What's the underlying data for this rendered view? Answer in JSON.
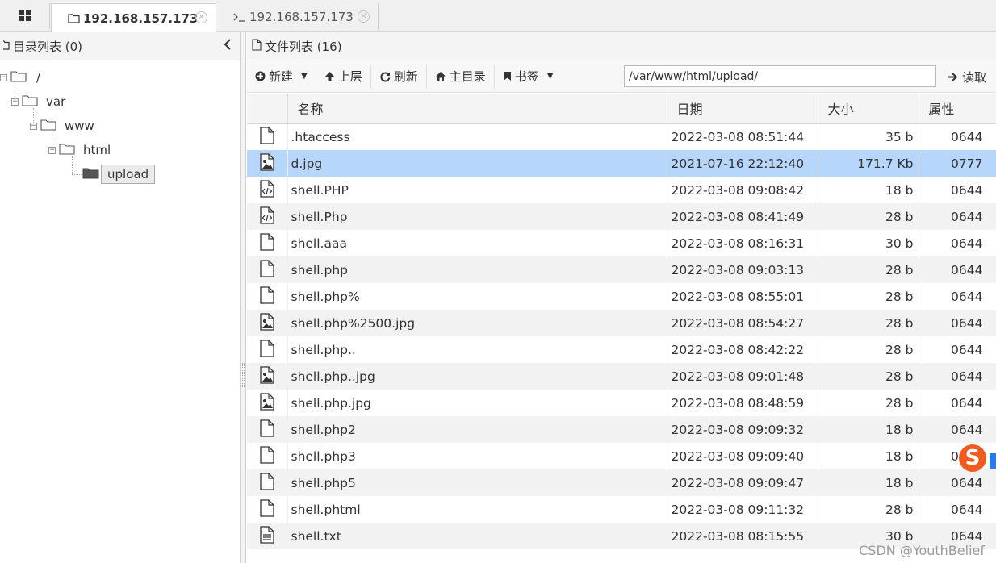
{
  "tabs": [
    {
      "label": "192.168.157.173",
      "active": true
    },
    {
      "label": "192.168.157.173",
      "active": false
    }
  ],
  "tree": {
    "header": "目录列表 (0)",
    "nodes": [
      {
        "label": "/"
      },
      {
        "label": "var"
      },
      {
        "label": "www"
      },
      {
        "label": "html"
      },
      {
        "label": "upload"
      }
    ]
  },
  "files": {
    "header": "文件列表 (16)",
    "toolbar": {
      "new_label": "新建",
      "up_label": "上层",
      "refresh_label": "刷新",
      "home_label": "主目录",
      "bookmark_label": "书签",
      "path_value": "/var/www/html/upload/",
      "read_label": "读取"
    },
    "columns": {
      "name": "名称",
      "date": "日期",
      "size": "大小",
      "perm": "属性"
    },
    "rows": [
      {
        "type": "file",
        "name": ".htaccess",
        "date": "2022-03-08 08:51:44",
        "size": "35 b",
        "perm": "0644"
      },
      {
        "type": "image",
        "name": "d.jpg",
        "date": "2021-07-16 22:12:40",
        "size": "171.7 Kb",
        "perm": "0777",
        "selected": true
      },
      {
        "type": "code",
        "name": "shell.PHP",
        "date": "2022-03-08 09:08:42",
        "size": "18 b",
        "perm": "0644"
      },
      {
        "type": "code",
        "name": "shell.Php",
        "date": "2022-03-08 08:41:49",
        "size": "28 b",
        "perm": "0644"
      },
      {
        "type": "file",
        "name": "shell.aaa",
        "date": "2022-03-08 08:16:31",
        "size": "30 b",
        "perm": "0644"
      },
      {
        "type": "file",
        "name": "shell.php",
        "date": "2022-03-08 09:03:13",
        "size": "28 b",
        "perm": "0644"
      },
      {
        "type": "file",
        "name": "shell.php%",
        "date": "2022-03-08 08:55:01",
        "size": "28 b",
        "perm": "0644"
      },
      {
        "type": "image",
        "name": "shell.php%2500.jpg",
        "date": "2022-03-08 08:54:27",
        "size": "28 b",
        "perm": "0644"
      },
      {
        "type": "file",
        "name": "shell.php..",
        "date": "2022-03-08 08:42:22",
        "size": "28 b",
        "perm": "0644"
      },
      {
        "type": "image",
        "name": "shell.php..jpg",
        "date": "2022-03-08 09:01:48",
        "size": "28 b",
        "perm": "0644"
      },
      {
        "type": "image",
        "name": "shell.php.jpg",
        "date": "2022-03-08 08:48:59",
        "size": "28 b",
        "perm": "0644"
      },
      {
        "type": "file",
        "name": "shell.php2",
        "date": "2022-03-08 09:09:32",
        "size": "18 b",
        "perm": "0644"
      },
      {
        "type": "file",
        "name": "shell.php3",
        "date": "2022-03-08 09:09:40",
        "size": "18 b",
        "perm": "0644"
      },
      {
        "type": "file",
        "name": "shell.php5",
        "date": "2022-03-08 09:09:47",
        "size": "18 b",
        "perm": "0644"
      },
      {
        "type": "file",
        "name": "shell.phtml",
        "date": "2022-03-08 09:11:32",
        "size": "28 b",
        "perm": "0644"
      },
      {
        "type": "text",
        "name": "shell.txt",
        "date": "2022-03-08 08:15:55",
        "size": "30 b",
        "perm": "0644"
      }
    ]
  },
  "watermark": "CSDN @YouthBelief",
  "ime_badge": "S",
  "icons": {
    "home_tab": "grid-icon",
    "site_tab": "folder-icon",
    "terminal_tab": "terminal-icon",
    "file": "file-icon",
    "image": "image-file-icon",
    "code": "code-file-icon",
    "text": "text-file-icon"
  },
  "colors": {
    "selected_row": "#b7d6fb",
    "ime_badge": "#f25a1d"
  }
}
